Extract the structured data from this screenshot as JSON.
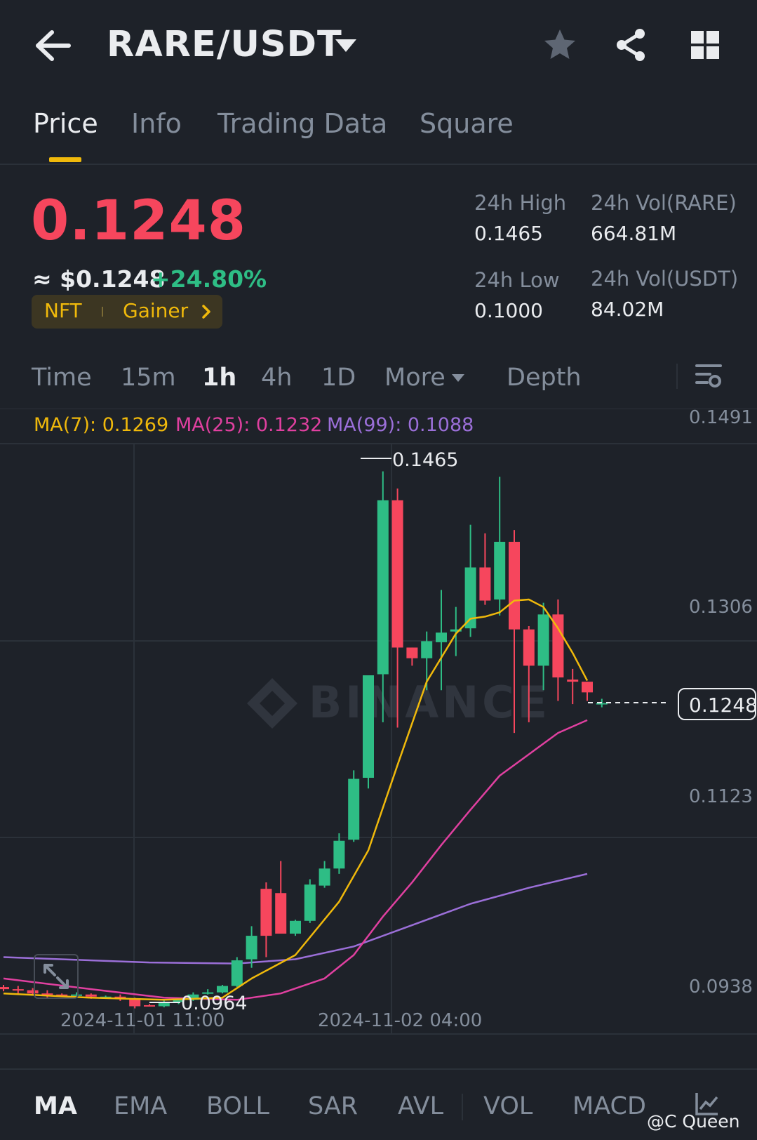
{
  "header": {
    "pair": "RARE/USDT",
    "icons": [
      "back-arrow-icon",
      "caret-down-icon",
      "star-icon",
      "share-icon",
      "grid-icon"
    ]
  },
  "tabs": [
    "Price",
    "Info",
    "Trading Data",
    "Square"
  ],
  "active_tab": "Price",
  "price": {
    "last": "0.1248",
    "approx": "≈ $0.1248",
    "change": "+24.80%",
    "tag1": "NFT",
    "tag2": "Gainer"
  },
  "stats": {
    "high_label": "24h High",
    "high": "0.1465",
    "low_label": "24h Low",
    "low": "0.1000",
    "vol_base_label": "24h Vol(RARE)",
    "vol_base": "664.81M",
    "vol_quote_label": "24h Vol(USDT)",
    "vol_quote": "84.02M"
  },
  "timeframes": [
    "Time",
    "15m",
    "1h",
    "4h",
    "1D",
    "More",
    "Depth"
  ],
  "active_timeframe": "1h",
  "ma_legend": {
    "ma7": "MA(7): 0.1269",
    "ma25": "MA(25): 0.1232",
    "ma99": "MA(99): 0.1088"
  },
  "chart_data": {
    "type": "candlestick",
    "y_ticks": [
      "0.1491",
      "0.1306",
      "0.1123",
      "0.0938"
    ],
    "x_ticks": [
      "2024-11-01 11:00",
      "2024-11-02 04:00"
    ],
    "current_price": "0.1248",
    "high_label": "0.1465",
    "low_label": "0.0964",
    "candles": [
      [
        0.0982,
        0.0984,
        0.0978,
        0.098
      ],
      [
        0.098,
        0.0983,
        0.0976,
        0.0979
      ],
      [
        0.0979,
        0.0981,
        0.0974,
        0.0976
      ],
      [
        0.0976,
        0.0979,
        0.0972,
        0.0975
      ],
      [
        0.0975,
        0.0976,
        0.0973,
        0.0974
      ],
      [
        0.0974,
        0.0977,
        0.0972,
        0.0975
      ],
      [
        0.0975,
        0.0976,
        0.0971,
        0.0973
      ],
      [
        0.0973,
        0.0974,
        0.0972,
        0.0973
      ],
      [
        0.0973,
        0.0975,
        0.0969,
        0.0971
      ],
      [
        0.0971,
        0.0972,
        0.0962,
        0.0964
      ],
      [
        0.0965,
        0.0966,
        0.0964,
        0.0964
      ],
      [
        0.0964,
        0.097,
        0.0963,
        0.0968
      ],
      [
        0.0968,
        0.0971,
        0.0966,
        0.097
      ],
      [
        0.097,
        0.0977,
        0.0969,
        0.0975
      ],
      [
        0.0976,
        0.098,
        0.0975,
        0.0977
      ],
      [
        0.0977,
        0.0984,
        0.0976,
        0.0983
      ],
      [
        0.0983,
        0.101,
        0.0982,
        0.1007
      ],
      [
        0.1008,
        0.1039,
        0.1,
        0.103
      ],
      [
        0.1074,
        0.108,
        0.101,
        0.103
      ],
      [
        0.107,
        0.11,
        0.104,
        0.1032
      ],
      [
        0.1032,
        0.1045,
        0.103,
        0.1044
      ],
      [
        0.1044,
        0.1083,
        0.1042,
        0.1078
      ],
      [
        0.1077,
        0.11,
        0.1075,
        0.1093
      ],
      [
        0.1093,
        0.1126,
        0.1088,
        0.1119
      ],
      [
        0.112,
        0.1185,
        0.1118,
        0.1177
      ],
      [
        0.1178,
        0.1272,
        0.1168,
        0.1274
      ],
      [
        0.1275,
        0.1465,
        0.123,
        0.1438
      ],
      [
        0.1438,
        0.1449,
        0.1225,
        0.13
      ],
      [
        0.13,
        0.13,
        0.1283,
        0.129
      ],
      [
        0.129,
        0.1315,
        0.126,
        0.1306
      ],
      [
        0.1305,
        0.1354,
        0.126,
        0.1314
      ],
      [
        0.1315,
        0.1338,
        0.1292,
        0.1317
      ],
      [
        0.1318,
        0.1415,
        0.131,
        0.1375
      ],
      [
        0.1375,
        0.1407,
        0.134,
        0.1344
      ],
      [
        0.1345,
        0.146,
        0.133,
        0.1399
      ],
      [
        0.1399,
        0.141,
        0.122,
        0.1317
      ],
      [
        0.1317,
        0.132,
        0.123,
        0.1283
      ],
      [
        0.1283,
        0.1342,
        0.126,
        0.1331
      ],
      [
        0.1331,
        0.1345,
        0.125,
        0.1272
      ],
      [
        0.127,
        0.128,
        0.1247,
        0.1268
      ],
      [
        0.1268,
        0.1268,
        0.125,
        0.1258
      ],
      [
        0.1247,
        0.1252,
        0.1244,
        0.1248
      ]
    ],
    "ma7": [
      [
        0,
        0.0976
      ],
      [
        6,
        0.0972
      ],
      [
        11,
        0.097
      ],
      [
        15,
        0.0972
      ],
      [
        17,
        0.099
      ],
      [
        20,
        0.1012
      ],
      [
        23,
        0.1062
      ],
      [
        25,
        0.111
      ],
      [
        27,
        0.119
      ],
      [
        29,
        0.1268
      ],
      [
        31,
        0.1313
      ],
      [
        32,
        0.1327
      ],
      [
        33,
        0.1329
      ],
      [
        34,
        0.1333
      ],
      [
        35,
        0.1344
      ],
      [
        36,
        0.1345
      ],
      [
        37,
        0.1338
      ],
      [
        38,
        0.1318
      ],
      [
        39,
        0.1295
      ],
      [
        40,
        0.1269
      ]
    ],
    "ma25": [
      [
        0,
        0.099
      ],
      [
        6,
        0.098
      ],
      [
        11,
        0.0972
      ],
      [
        16,
        0.097
      ],
      [
        19,
        0.0976
      ],
      [
        22,
        0.099
      ],
      [
        24,
        0.1012
      ],
      [
        26,
        0.1048
      ],
      [
        28,
        0.108
      ],
      [
        30,
        0.1115
      ],
      [
        32,
        0.1148
      ],
      [
        34,
        0.118
      ],
      [
        36,
        0.12
      ],
      [
        38,
        0.122
      ],
      [
        40,
        0.1232
      ]
    ],
    "ma99": [
      [
        0,
        0.101
      ],
      [
        10,
        0.1005
      ],
      [
        16,
        0.1004
      ],
      [
        20,
        0.1008
      ],
      [
        24,
        0.102
      ],
      [
        28,
        0.104
      ],
      [
        32,
        0.106
      ],
      [
        36,
        0.1075
      ],
      [
        40,
        0.1088
      ]
    ]
  },
  "indicators": [
    "MA",
    "EMA",
    "BOLL",
    "SAR",
    "AVL",
    "VOL",
    "MACD"
  ],
  "active_indicator": "MA",
  "watermark": "@C Queen",
  "colors": {
    "up": "#2ebd85",
    "down": "#f6465d",
    "ma7": "#f0b90b",
    "ma25": "#e040a0",
    "ma99": "#9b6fd8",
    "accent": "#f0b90b"
  }
}
